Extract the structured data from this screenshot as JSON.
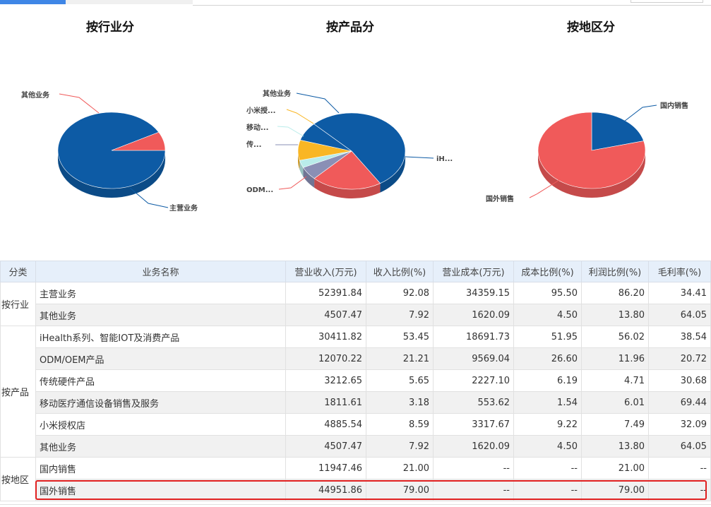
{
  "chart_data": [
    {
      "type": "pie",
      "title": "按行业分",
      "labels": [
        "主营业务",
        "其他业务"
      ],
      "values": [
        92.08,
        7.92
      ],
      "colors": [
        "#0d5ba5",
        "#f05a5a"
      ]
    },
    {
      "type": "pie",
      "title": "按产品分",
      "labels": [
        "iH...",
        "ODM...",
        "传...",
        "移动...",
        "小米授...",
        "其他业务"
      ],
      "full_labels": [
        "iHealth系列、智能IOT及消费产品",
        "ODM/OEM产品",
        "传统硬件产品",
        "移动医疗通信设备销售及服务",
        "小米授权店",
        "其他业务"
      ],
      "values": [
        53.45,
        21.21,
        5.65,
        3.18,
        8.59,
        7.92
      ],
      "colors": [
        "#0d5ba5",
        "#f05a5a",
        "#8a8fb5",
        "#b9ecea",
        "#f9b624",
        "#0d5ba5"
      ]
    },
    {
      "type": "pie",
      "title": "按地区分",
      "labels": [
        "国内销售",
        "国外销售"
      ],
      "values": [
        21.0,
        79.0
      ],
      "colors": [
        "#0d5ba5",
        "#f05a5a"
      ]
    }
  ],
  "table": {
    "headers": [
      "分类",
      "业务名称",
      "营业收入(万元)",
      "收入比例(%)",
      "营业成本(万元)",
      "成本比例(%)",
      "利润比例(%)",
      "毛利率(%)"
    ],
    "groups": [
      {
        "category": "按行业",
        "rows": [
          [
            "主营业务",
            "52391.84",
            "92.08",
            "34359.15",
            "95.50",
            "86.20",
            "34.41"
          ],
          [
            "其他业务",
            "4507.47",
            "7.92",
            "1620.09",
            "4.50",
            "13.80",
            "64.05"
          ]
        ]
      },
      {
        "category": "按产品",
        "rows": [
          [
            "iHealth系列、智能IOT及消费产品",
            "30411.82",
            "53.45",
            "18691.73",
            "51.95",
            "56.02",
            "38.54"
          ],
          [
            "ODM/OEM产品",
            "12070.22",
            "21.21",
            "9569.04",
            "26.60",
            "11.96",
            "20.72"
          ],
          [
            "传统硬件产品",
            "3212.65",
            "5.65",
            "2227.10",
            "6.19",
            "4.71",
            "30.68"
          ],
          [
            "移动医疗通信设备销售及服务",
            "1811.61",
            "3.18",
            "553.62",
            "1.54",
            "6.01",
            "69.44"
          ],
          [
            "小米授权店",
            "4885.54",
            "8.59",
            "3317.67",
            "9.22",
            "7.49",
            "32.09"
          ],
          [
            "其他业务",
            "4507.47",
            "7.92",
            "1620.09",
            "4.50",
            "13.80",
            "64.05"
          ]
        ]
      },
      {
        "category": "按地区",
        "rows": [
          [
            "国内销售",
            "11947.46",
            "21.00",
            "--",
            "--",
            "21.00",
            "--"
          ],
          [
            "国外销售",
            "44951.86",
            "79.00",
            "--",
            "--",
            "79.00",
            "--"
          ]
        ]
      }
    ]
  }
}
